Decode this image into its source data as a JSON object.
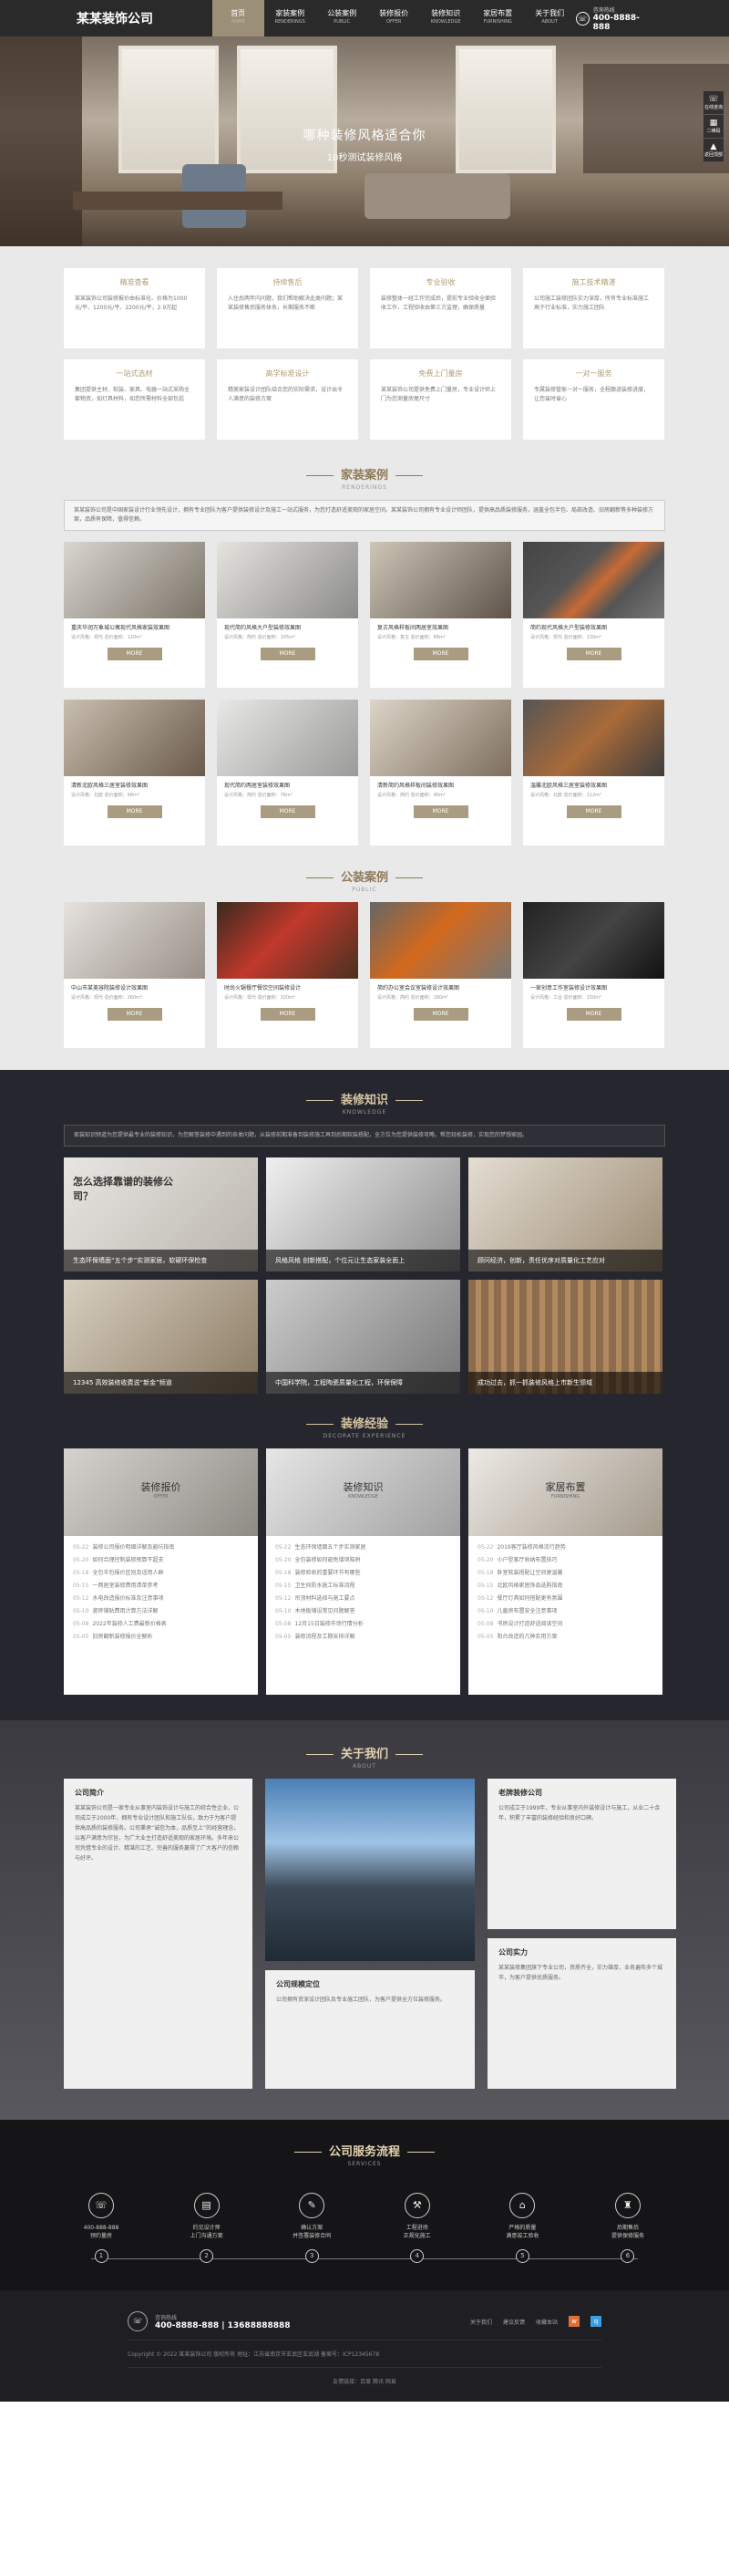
{
  "header": {
    "logo": "某某装饰公司",
    "nav": [
      {
        "cn": "首页",
        "en": "HOME"
      },
      {
        "cn": "家装案例",
        "en": "RENDERINGS"
      },
      {
        "cn": "公装案例",
        "en": "PUBLIC"
      },
      {
        "cn": "装修报价",
        "en": "OFFER"
      },
      {
        "cn": "装修知识",
        "en": "KNOWLEDGE"
      },
      {
        "cn": "家居布置",
        "en": "FURNISHING"
      },
      {
        "cn": "关于我们",
        "en": "ABOUT"
      }
    ],
    "hotline_label": "咨询热线",
    "hotline": "400-8888-888"
  },
  "banner": {
    "title": "哪种装修风格适合你",
    "subtitle": "10秒测试装修风格"
  },
  "sidebar": [
    {
      "icon": "☏",
      "label": "在线咨询"
    },
    {
      "icon": "▦",
      "label": "二维码"
    },
    {
      "icon": "▲",
      "label": "返回顶部"
    }
  ],
  "features": [
    {
      "title": "精准查看",
      "desc": "某某装饰公司装修报价由标准化、价格为1000元/平、1200元/平、2200元/平，2.9万起"
    },
    {
      "title": "持续售后",
      "desc": "入住后两年内问题，我们帮助解决此类问题；某某装修售后服务体系，长期服务不断"
    },
    {
      "title": "专业验收",
      "desc": "装修整体一经工作完成后，提前专业验收全面验收工作，工程验收由第三方监理，确保质量"
    },
    {
      "title": "施工技术精湛",
      "desc": "公司施工装修团队实力深厚，所有专业标准施工高于行业标准，实力施工团队"
    },
    {
      "title": "一站式选材",
      "desc": "集团提供主材、软装、家具、电器一站式采购全套物资，如灯具材料，如您所需材料全部包括"
    },
    {
      "title": "高学标准设计",
      "desc": "精美家装设计团队结合您的实际需求，设计出令人满意的装修方案"
    },
    {
      "title": "免费上门量房",
      "desc": "某某装饰公司提供免费上门量房，专业设计师上门为您测量房屋尺寸"
    },
    {
      "title": "一对一服务",
      "desc": "专属装修管家一对一服务，全程跟进装修进度，让您省时省心"
    }
  ],
  "renderings": {
    "title": "家装案例",
    "subtitle": "RENDERINGS",
    "intro": "某某装饰公司是中国家装设计行业领先设计，拥有专业团队为客户提供装修设计及施工一站式服务，为您打造舒适美观的家居空间。某某装饰公司拥有专业设计师团队，提供高品质装修服务，涵盖全包半包、局部改造、旧房翻新等多种装修方案，品质有保障，值得信赖。",
    "more": "MORE",
    "items": [
      {
        "title": "重庆华润万象城公寓现代风格家装效果图",
        "meta": "设计风格：现代   造价面积：120m²"
      },
      {
        "title": "现代简约风格大户型装修效果图",
        "meta": "设计风格：简约   造价面积：105m²"
      },
      {
        "title": "复古风格样板间两居室效果图",
        "meta": "设计风格：复古   造价面积：88m²"
      },
      {
        "title": "简约现代风格大户型装修效果图",
        "meta": "设计风格：现代   造价面积：130m²"
      },
      {
        "title": "清新北欧风格三居室装修效果图",
        "meta": "设计风格：北欧   造价面积：98m²"
      },
      {
        "title": "现代简约两居室装修效果图",
        "meta": "设计风格：简约   造价面积：76m²"
      },
      {
        "title": "清新简约风格样板间装修效果图",
        "meta": "设计风格：简约   造价面积：90m²"
      },
      {
        "title": "温馨北欧风格三居室装修效果图",
        "meta": "设计风格：北欧   造价面积：112m²"
      }
    ]
  },
  "public": {
    "title": "公装案例",
    "subtitle": "PUBLIC",
    "more": "MORE",
    "items": [
      {
        "title": "中山市某美容院装修设计效果图",
        "meta": "设计风格：现代   造价面积：260m²"
      },
      {
        "title": "时尚火锅餐厅餐饮空间装修设计",
        "meta": "设计风格：现代   造价面积：320m²"
      },
      {
        "title": "简约办公室会议室装修设计效果图",
        "meta": "设计风格：简约   造价面积：180m²"
      },
      {
        "title": "一家创意工作室装修设计效果图",
        "meta": "设计风格：工业   造价面积：150m²"
      }
    ]
  },
  "knowledge": {
    "title": "装修知识",
    "subtitle": "KNOWLEDGE",
    "intro": "家装知识频道为您提供最专业的装修知识，为您解答装修中遇到的各类问题，从装修前期准备到装修施工再到后期软装搭配，全方位为您提供装修攻略，帮您轻松装修，实现您的梦想家园。",
    "items": [
      {
        "cap": "生态环保墙面“五个步”实测家居，软硬环保检查",
        "overlay": "怎么选择靠谱的装修公司？"
      },
      {
        "cap": "风格风格 创新搭配，个位元让生态家装全面上",
        "overlay": ""
      },
      {
        "cap": "顾问经济，创新，责任优序对质量化工艺应对",
        "overlay": ""
      },
      {
        "cap": "12345 高效装修收费说“新金”频道",
        "overlay": ""
      },
      {
        "cap": "中国科学院，工程陶瓷质量化工程，环保保障",
        "overlay": ""
      },
      {
        "cap": "成功过去，抓一抓装修风格上市新生领域",
        "overlay": ""
      }
    ]
  },
  "experience": {
    "title": "装修经验",
    "subtitle": "DECORATE EXPERIENCE",
    "cols": [
      {
        "title": "装修报价",
        "en": "OFFER",
        "items": [
          {
            "date": "05-22",
            "text": "装修公司报价明细详解及避坑指南"
          },
          {
            "date": "05-20",
            "text": "如何合理控制装修预算不超支"
          },
          {
            "date": "05-18",
            "text": "全包半包报价区别及适用人群"
          },
          {
            "date": "05-15",
            "text": "一两居室装修费用清单参考"
          },
          {
            "date": "05-12",
            "text": "水电改造报价标准及注意事项"
          },
          {
            "date": "05-10",
            "text": "瓷砖铺贴费用计算方法详解"
          },
          {
            "date": "05-08",
            "text": "2022年装修人工费最新价格表"
          },
          {
            "date": "05-05",
            "text": "旧房翻新装修报价全解析"
          }
        ]
      },
      {
        "title": "装修知识",
        "en": "KNOWLEDGE",
        "items": [
          {
            "date": "05-22",
            "text": "生态环保墙面五个步实测家居"
          },
          {
            "date": "05-20",
            "text": "全包装修如何避免增项陷阱"
          },
          {
            "date": "05-18",
            "text": "装修验收的重要环节有哪些"
          },
          {
            "date": "05-15",
            "text": "卫生间防水施工标准流程"
          },
          {
            "date": "05-12",
            "text": "吊顶材料选择与施工要点"
          },
          {
            "date": "05-10",
            "text": "木地板铺设常见问题解答"
          },
          {
            "date": "05-08",
            "text": "12月15日装修市场行情分析"
          },
          {
            "date": "05-05",
            "text": "装修流程及工期安排详解"
          }
        ]
      },
      {
        "title": "家居布置",
        "en": "FURNISHING",
        "items": [
          {
            "date": "05-22",
            "text": "2019客厅装修风格流行趋势"
          },
          {
            "date": "05-20",
            "text": "小户型客厅收纳布置技巧"
          },
          {
            "date": "05-18",
            "text": "卧室软装搭配让空间更温馨"
          },
          {
            "date": "05-15",
            "text": "北欧风格家居饰品选购指南"
          },
          {
            "date": "05-12",
            "text": "餐厅灯具如何搭配更有氛围"
          },
          {
            "date": "05-10",
            "text": "儿童房布置安全注意事项"
          },
          {
            "date": "05-08",
            "text": "书房设计打造舒适阅读空间"
          },
          {
            "date": "05-05",
            "text": "阳台改造的几种实用方案"
          }
        ]
      }
    ]
  },
  "about": {
    "title": "关于我们",
    "subtitle": "ABOUT",
    "intro_title": "公司简介",
    "intro_text": "某某装饰公司是一家专业从事室内装饰设计与施工的综合性企业，公司成立于2000年，拥有专业设计团队和施工队伍，致力于为客户提供高品质的装修服务。公司秉承“诚信为本，品质至上”的经营理念，以客户满意为宗旨，为广大业主打造舒适美观的家居环境。多年来公司凭借专业的设计、精湛的工艺、完善的服务赢得了广大客户的信赖与好评。",
    "team_title": "公司规模定位",
    "team_text": "公司拥有资深设计团队及专业施工团队，为客户提供全方位装修服务。",
    "history_title": "老牌装修公司",
    "history_text": "公司成立于1999年，专业从事室内外装修设计与施工，从业二十余年，积累了丰富的装修经验和良好口碑。",
    "strength_title": "公司实力",
    "strength_text": "某某装修集团旗下专业公司，资质齐全，实力雄厚，业务遍布多个城市，为客户提供优质服务。"
  },
  "process": {
    "title": "公司服务流程",
    "subtitle": "SERVICES",
    "steps": [
      {
        "icon": "☏",
        "text": "400-888-888\n预约量房",
        "num": "1"
      },
      {
        "icon": "▤",
        "text": "约见设计师\n上门沟通方案",
        "num": "2"
      },
      {
        "icon": "✎",
        "text": "确认方案\n并签署装修合同",
        "num": "3"
      },
      {
        "icon": "⚒",
        "text": "工程进场\n正规化施工",
        "num": "4"
      },
      {
        "icon": "⌂",
        "text": "严格的质量\n满意竣工验收",
        "num": "5"
      },
      {
        "icon": "♜",
        "text": "后期售后\n提供保修服务",
        "num": "6"
      }
    ]
  },
  "footer": {
    "label": "咨询热线",
    "phones": "400-8888-888 | 13688888888",
    "links": [
      "关于我们",
      "建议反馈",
      "收藏本站"
    ],
    "copyright": "Copyright © 2022 某某装饰公司 版权所有   地址：江苏省南京市玄武区玄武湖   备案号：ICP12345678",
    "friend": "友情链接：百度  腾讯  网易"
  }
}
